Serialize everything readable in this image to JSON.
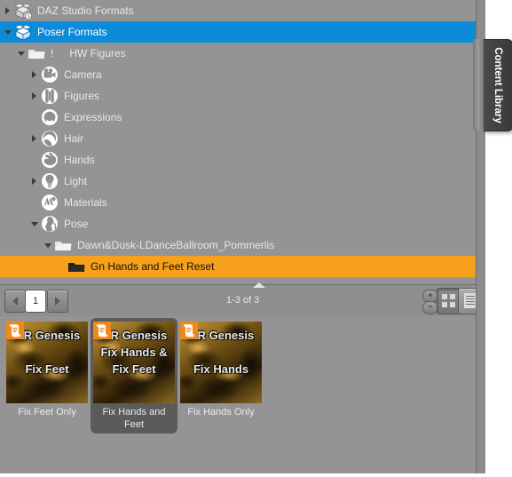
{
  "panel": {
    "dock_tab_label": "Content Library",
    "accent_orange": "#f7a01b",
    "accent_blue": "#0c8bd9",
    "background": "#949494"
  },
  "tree": {
    "items": [
      {
        "label": "DAZ Studio Formats",
        "icon": "open-box-icon",
        "arrow": "right",
        "indent": 0,
        "state": "normal"
      },
      {
        "label": "Poser Formats",
        "icon": "open-box-blue-icon",
        "arrow": "down",
        "indent": 0,
        "state": "selected-blue"
      },
      {
        "label": "HW Figures",
        "icon": "folder-icon",
        "arrow": "down",
        "indent": 1,
        "state": "normal",
        "prefix": "!"
      },
      {
        "label": "Camera",
        "icon": "camera-icon",
        "arrow": "right",
        "indent": 2,
        "state": "normal"
      },
      {
        "label": "Figures",
        "icon": "figure-icon",
        "arrow": "right",
        "indent": 2,
        "state": "normal"
      },
      {
        "label": "Expressions",
        "icon": "expression-icon",
        "arrow": "none",
        "indent": 2,
        "state": "normal"
      },
      {
        "label": "Hair",
        "icon": "hair-icon",
        "arrow": "right",
        "indent": 2,
        "state": "normal"
      },
      {
        "label": "Hands",
        "icon": "hand-icon",
        "arrow": "none",
        "indent": 2,
        "state": "normal"
      },
      {
        "label": "Light",
        "icon": "light-bulb-icon",
        "arrow": "right",
        "indent": 2,
        "state": "normal"
      },
      {
        "label": "Materials",
        "icon": "materials-icon",
        "arrow": "none",
        "indent": 2,
        "state": "normal"
      },
      {
        "label": "Pose",
        "icon": "pose-icon",
        "arrow": "down",
        "indent": 2,
        "state": "normal"
      },
      {
        "label": "Dawn&Dusk-LDanceBallroom_Pommerlis",
        "icon": "folder-icon",
        "arrow": "down",
        "indent": 3,
        "state": "normal"
      },
      {
        "label": "Gn Hands and Feet Reset",
        "icon": "folder-dark-icon",
        "arrow": "none",
        "indent": 4,
        "state": "selected-orange"
      }
    ]
  },
  "pager": {
    "prev_icon": "arrow-left-icon",
    "next_icon": "arrow-right-icon",
    "page_value": "1",
    "range_label": "1-3 of 3",
    "zoom_in_label": "+",
    "zoom_out_label": "−",
    "view_grid_icon": "grid-view-icon",
    "view_list_icon": "list-view-icon"
  },
  "thumbnails": {
    "items": [
      {
        "caption": "Fix Feet Only",
        "tile_lines": [
          "MR Genesis",
          "",
          "Fix Feet"
        ],
        "badge_icon": "script-badge-icon",
        "selected": false
      },
      {
        "caption": "Fix Hands and Feet",
        "tile_lines": [
          "MR Genesis",
          "Fix Hands &",
          "Fix Feet"
        ],
        "badge_icon": "script-badge-icon",
        "selected": true
      },
      {
        "caption": "Fix Hands Only",
        "tile_lines": [
          "MR Genesis",
          "",
          "Fix Hands"
        ],
        "badge_icon": "script-badge-icon",
        "selected": false
      }
    ]
  }
}
